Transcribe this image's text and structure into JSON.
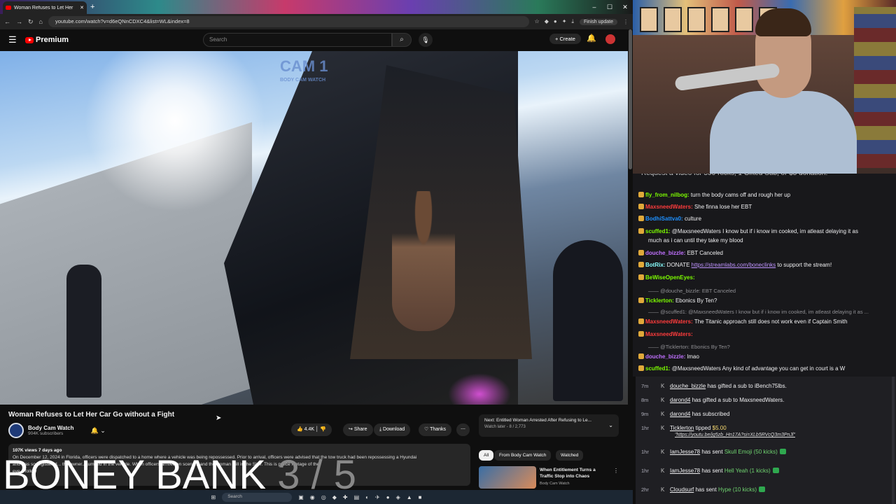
{
  "browser": {
    "tab_title": "Woman Refuses to Let Her",
    "url": "youtube.com/watch?v=d6eQNnCDXC4&list=WL&index=8",
    "finish_update": "Finish update"
  },
  "yt_header": {
    "logo_text": "Premium",
    "search_placeholder": "Search",
    "create_label": "Create"
  },
  "video": {
    "watermark": "CAM 1",
    "watermark_sub": "BODY CAM WATCH",
    "title": "Woman Refuses to Let Her Car Go without a Fight",
    "channel_name": "Body Cam Watch",
    "channel_subs": "904K subscribers",
    "likes": "4.4K",
    "share_label": "Share",
    "download_label": "Download",
    "thanks_label": "Thanks",
    "views_line": "107K views  7 days ago",
    "description_line1": "On December 12, 2024 in Florida, officers were dispatched to a home where a vehicle was being repossessed. Prior to arrival, officers were advised that the tow truck had been repossessing a Hyundai",
    "description_line2": "and was so registered... the owner... jumped in the vehicle. When officers arrived on scene... and the woman still in the SUV. This is police footage of the",
    "description_line3": "eve... follow"
  },
  "up_next": {
    "line1": "Next: Entitled Woman Arrested After Refusing to Le...",
    "line2": "Watch later - 8 / 2,773"
  },
  "chips": [
    "All",
    "From Body Cam Watch",
    "Watched"
  ],
  "recommendation": {
    "title": "When Entitlement Turns a Traffic Stop into Chaos",
    "channel": "Body Cam Watch"
  },
  "taskbar": {
    "search": "Search"
  },
  "overlay": {
    "text": "BONEY BANK",
    "count": "3 / 5"
  },
  "chat": {
    "header": "Request a video for 500 Kicks, 1 Gifted Sub, or $5 donation.",
    "messages": [
      {
        "user": "fly_from_nilbog:",
        "text": " turn the body cams off and rough her up",
        "color": "#7cfc00"
      },
      {
        "user": "MaxsneedWaters:",
        "text": " She finna lose her EBT",
        "color": "#ff3c3c"
      },
      {
        "user": "BodhiSattva0:",
        "text": " culture",
        "color": "#1e90ff"
      },
      {
        "user": "scuffed1:",
        "text": " @MaxsneedWaters I know but if i know im cooked, im atleast delaying it as",
        "color": "#7cfc00"
      },
      {
        "user": "",
        "text": "much as i can until they take my blood",
        "color": "#efeff1"
      },
      {
        "user": "douche_bizzle:",
        "text": " EBT Canceled",
        "color": "#c070ff"
      },
      {
        "user": "BotRix:",
        "text": " DONATE ",
        "link": "https://streamlabs.com/boneclinks",
        "tail": " to support the stream!",
        "color": "#8ff"
      },
      {
        "user": "BeWiseOpenEyes:",
        "text": "",
        "color": "#7cfc00"
      },
      {
        "user": "@douche_bizzle: EBT Canceled",
        "text": "",
        "reply": true
      },
      {
        "user": "Ticklerton:",
        "text": " Ebonics By Ten?",
        "color": "#7cfc00"
      },
      {
        "user": "@scuffed1: @MaxsneedWaters I know but if i know im cooked, im atleast delaying it as ...",
        "text": "",
        "reply": true
      },
      {
        "user": "MaxsneedWaters:",
        "text": " The Titanic approach still does not work even if Captain Smith",
        "color": "#ff3c3c"
      },
      {
        "user": "MaxsneedWaters:",
        "text": "",
        "color": "#ff3c3c"
      },
      {
        "user": "@Ticklerton: Ebonics By Ten?",
        "text": "",
        "reply": true
      },
      {
        "user": "douche_bizzle:",
        "text": " lmao",
        "color": "#c070ff"
      },
      {
        "user": "scuffed1:",
        "text": " @MaxsneedWaters Any kind of advantage you can get in court is a W",
        "color": "#7cfc00"
      }
    ]
  },
  "events": [
    {
      "time": "7m",
      "name": "douche_bizzle",
      "text": " has gifted a sub to ",
      "target": "iBench75lbs."
    },
    {
      "time": "8m",
      "name": "darond4",
      "text": " has gifted a sub to ",
      "target": "MaxsneedWaters."
    },
    {
      "time": "9m",
      "name": "darond4",
      "text": " has subscribed",
      "target": ""
    },
    {
      "time": "1hr",
      "name": "Ticklerton",
      "text": " tipped ",
      "target": "$5.00",
      "link": "https://youtu.be/jg5zb_Hn17A?si=XLb5RVcQ3m3PnJl"
    },
    {
      "time": "1hr",
      "name": "IamJesse78",
      "text": " has sent ",
      "gift": "Skull Emoji (50 kicks)"
    },
    {
      "time": "1hr",
      "name": "IamJesse78",
      "text": " has sent ",
      "gift": "Hell Yeah (1 kicks)"
    },
    {
      "time": "2hr",
      "name": "Cloudsurf",
      "text": " has sent ",
      "gift": "Hype (10 kicks)"
    }
  ],
  "colors": {
    "yt_red": "#ff0000",
    "chat_bg": "#18181b",
    "kick_green": "#53fc18"
  }
}
